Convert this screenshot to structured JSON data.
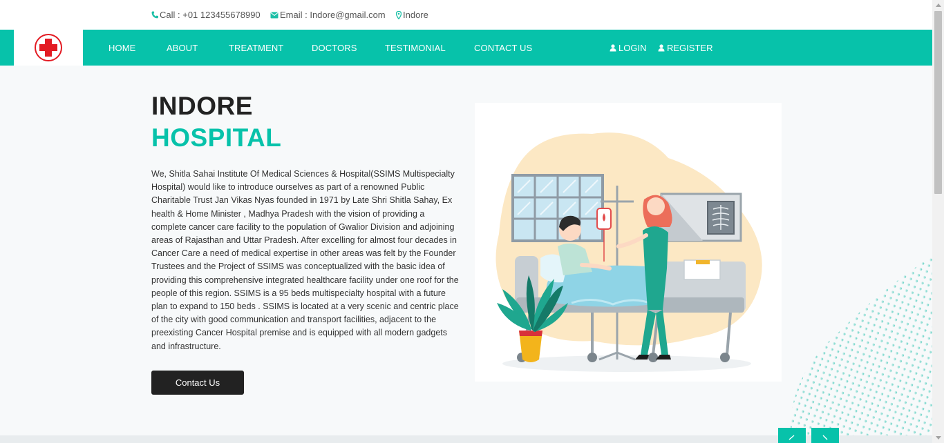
{
  "topbar": {
    "call": "Call : +01 123455678990",
    "email": "Email : Indore@gmail.com",
    "location": "Indore"
  },
  "nav": {
    "items": [
      {
        "label": "HOME"
      },
      {
        "label": "ABOUT"
      },
      {
        "label": "TREATMENT"
      },
      {
        "label": "DOCTORS"
      },
      {
        "label": "TESTIMONIAL"
      },
      {
        "label": "CONTACT US"
      }
    ],
    "login": "LOGIN",
    "register": "REGISTER"
  },
  "hero": {
    "title_line1": "INDORE",
    "title_line2": "HOSPITAL",
    "description": "We, Shitla Sahai Institute Of Medical Sciences & Hospital(SSIMS Multispecialty Hospital) would like to introduce ourselves as part of a renowned Public Charitable Trust Jan Vikas Nyas founded in 1971 by Late Shri Shitla Sahay, Ex health & Home Minister , Madhya Pradesh with the vision of providing a complete cancer care facility to the population of Gwalior Division and adjoining areas of Rajasthan and Uttar Pradesh. After excelling for almost four decades in Cancer Care a need of medical expertise in other areas was felt by the Founder Trustees and the Project of SSIMS was conceptualized with the basic idea of providing this comprehensive integrated healthcare facility under one roof for the people of this region. SSIMS is a 95 beds multispecialty hospital with a future plan to expand to 150 beds . SSIMS is located at a very scenic and centric place of the city with good communication and transport facilities, adjacent to the preexisting Cancer Hospital premise and is equipped with all modern gadgets and infrastructure.",
    "button": "Contact Us"
  },
  "colors": {
    "accent": "#07c2aa",
    "dark": "#222222",
    "logo_red": "#e31b23"
  },
  "icons": {
    "call": "phone-icon",
    "email": "envelope-icon",
    "location": "map-marker-icon",
    "login": "user-icon",
    "register": "user-icon"
  }
}
